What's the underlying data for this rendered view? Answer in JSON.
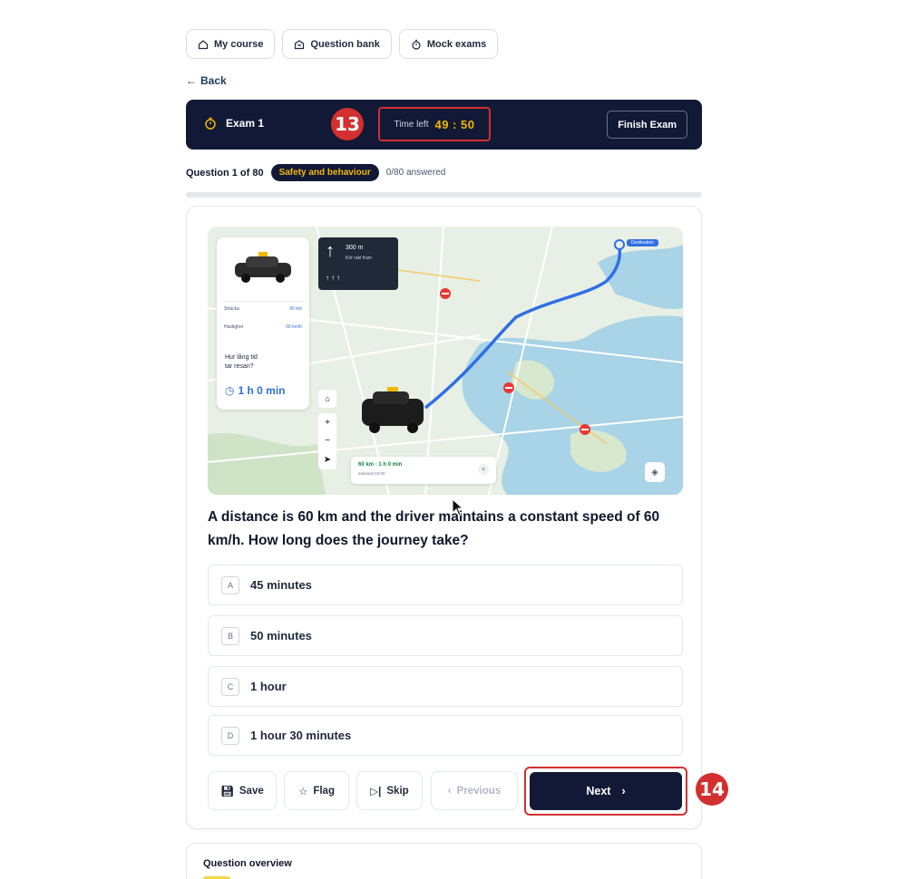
{
  "nav": {
    "my_course": "My course",
    "question_bank": "Question bank",
    "mock_exams": "Mock exams",
    "back": "Back"
  },
  "exam": {
    "title": "Exam 1",
    "time_label": "Time left",
    "time_value": "49 : 50",
    "finish": "Finish Exam"
  },
  "annotations": {
    "badge_13": "13",
    "badge_14": "14"
  },
  "question_meta": {
    "number": "Question 1 of 80",
    "category": "Safety and behaviour",
    "answered": "0/80 answered",
    "progress_fraction": 0
  },
  "map": {
    "car_panel": {
      "row1_label": "Sträcka",
      "row1_value": "60 km",
      "row2_label": "Hastighet",
      "row2_value": "60 km/h",
      "question_line1": "Hur lång tid",
      "question_line2": "tar resan?",
      "answer": "1 h 0 min"
    },
    "direction": {
      "distance": "300 m",
      "street": "Kör rakt fram"
    },
    "destination": "Destination",
    "route_summary": "60 km · 1 h 0 min",
    "route_sub": "ankomst 10:00"
  },
  "question": {
    "text": "A distance is 60 km and the driver maintains a constant speed of 60 km/h. How long does the journey take?"
  },
  "options": [
    {
      "letter": "A",
      "text": "45 minutes"
    },
    {
      "letter": "B",
      "text": "50 minutes"
    },
    {
      "letter": "C",
      "text": "1 hour"
    },
    {
      "letter": "D",
      "text": "1 hour 30 minutes"
    }
  ],
  "actions": {
    "save": "Save",
    "flag": "Flag",
    "skip": "Skip",
    "previous": "Previous",
    "next": "Next"
  },
  "overview": {
    "title": "Question overview"
  },
  "colors": {
    "navy": "#111936",
    "accent_yellow": "#f5b800",
    "annotation_red": "#d32f2f",
    "route_blue": "#2f6fe4"
  }
}
